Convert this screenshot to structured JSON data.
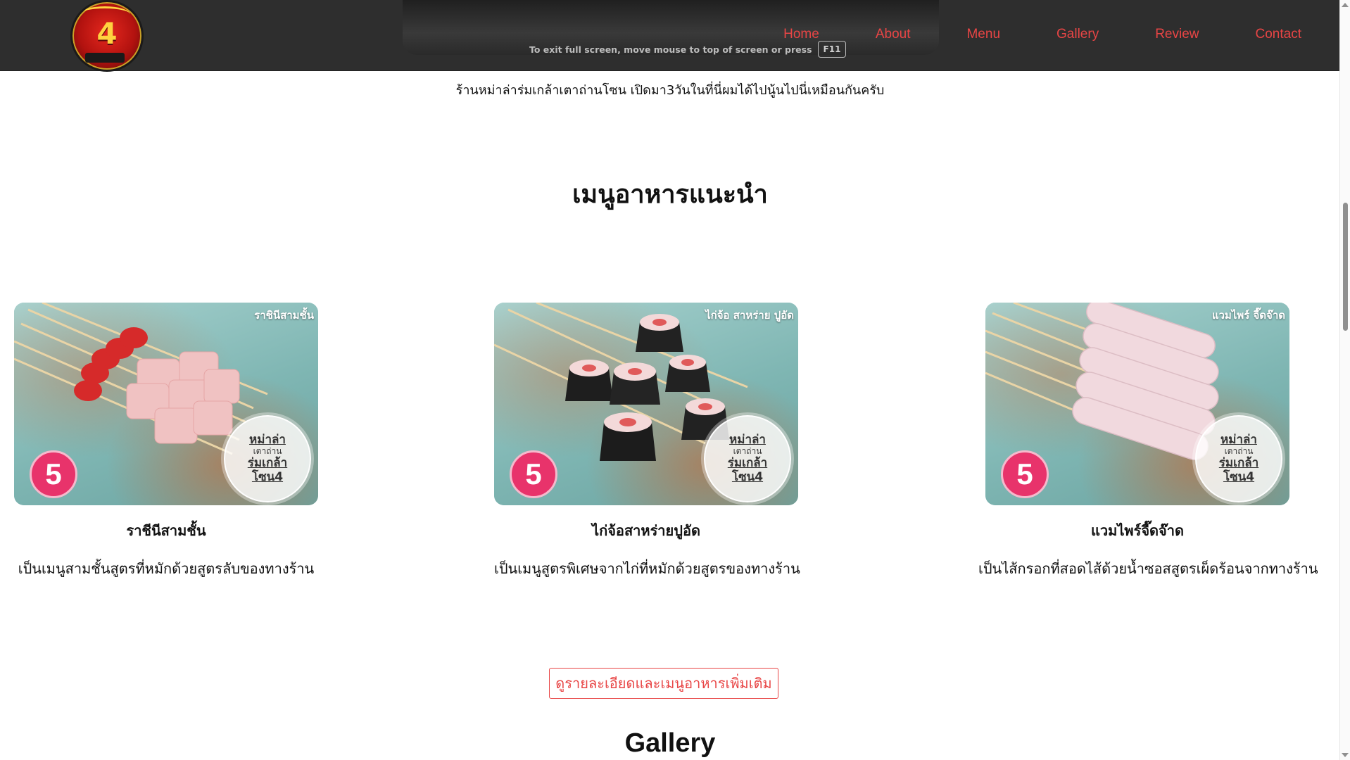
{
  "header": {
    "logo_icon": "restaurant-logo-icon",
    "logo_number": "4",
    "fullscreen_hint": "To exit full screen, move mouse to top of screen or press",
    "fullscreen_key": "F11",
    "nav": [
      {
        "label": "Home"
      },
      {
        "label": "About"
      },
      {
        "label": "Menu"
      },
      {
        "label": "Gallery"
      },
      {
        "label": "Review"
      },
      {
        "label": "Contact"
      }
    ],
    "nav_color": "#e84545",
    "bg_color": "#2e2e2e"
  },
  "intro_text": "ร้านหม่าล่าร่มเกล้าเตาถ่านโซน เปิดมา3วันในที่นี่ผมได้ไปนู้นไปนี่เหมือนกันครับ",
  "section_title": "เมนูอาหารแนะนำ",
  "cards": [
    {
      "photo_caption": "ราชินีสามชั้น",
      "badge": "5",
      "stamp": [
        "หม่าล่า",
        "เตาถ่าน",
        "ร่มเกล้า",
        "โซน4"
      ],
      "name": "ราชีนีสามชั้น",
      "desc": "เป็นเมนูสามชั้นสูตรที่หมักด้วยสูตรลับของทางร้าน"
    },
    {
      "photo_caption": "ไก่จ้อ สาหร่าย ปูอัด",
      "badge": "5",
      "stamp": [
        "หม่าล่า",
        "เตาถ่าน",
        "ร่มเกล้า",
        "โซน4"
      ],
      "name": "ไก่จ้อสาหร่ายปูอัด",
      "desc": "เป็นเมนูสูตรพิเศษจากไก่ที่หมักด้วยสูตรของทางร้าน"
    },
    {
      "photo_caption": "แวมไพร์ จี๊ดจ๊าด",
      "badge": "5",
      "stamp": [
        "หม่าล่า",
        "เตาถ่าน",
        "ร่มเกล้า",
        "โซน4"
      ],
      "name": "แวมไพร์จี๊ดจ๊าด",
      "desc": "เป็นไส้กรอกที่สอดไส้ด้วยน้ำซอสสูตรเผ็ดร้อนจากทางร้าน"
    }
  ],
  "more_button": "ดูรายละเอียดและเมนูอาหารเพิ่มเติม",
  "gallery_title": "Gallery",
  "accent_color": "#e84545",
  "badge_color": "#e8336b"
}
